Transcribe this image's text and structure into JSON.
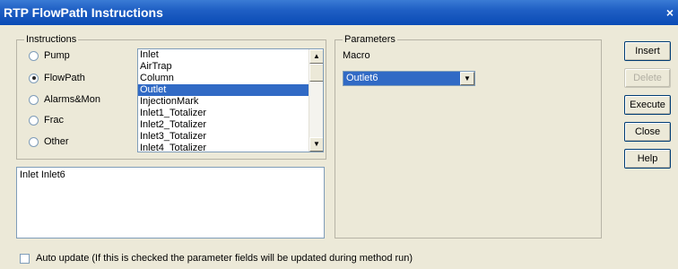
{
  "window": {
    "title": "RTP FlowPath Instructions",
    "close_glyph": "×"
  },
  "instructions": {
    "legend": "Instructions",
    "radios": [
      {
        "label": "Pump",
        "checked": false
      },
      {
        "label": "FlowPath",
        "checked": true
      },
      {
        "label": "Alarms&Mon",
        "checked": false
      },
      {
        "label": "Frac",
        "checked": false
      },
      {
        "label": "Other",
        "checked": false
      }
    ],
    "list_items": [
      "Inlet",
      "AirTrap",
      "Column",
      "Outlet",
      "InjectionMark",
      "Inlet1_Totalizer",
      "Inlet2_Totalizer",
      "Inlet3_Totalizer",
      "Inlet4_Totalizer"
    ],
    "selected_item": "Outlet"
  },
  "instruction_text": "Inlet Inlet6",
  "parameters": {
    "legend": "Parameters",
    "macro_label": "Macro",
    "macro_value": "Outlet6"
  },
  "buttons": {
    "insert": "Insert",
    "delete": "Delete",
    "execute": "Execute",
    "close": "Close",
    "help": "Help"
  },
  "auto_update": {
    "checked": false,
    "label": "Auto update (If this is checked the parameter fields will be updated during method run)"
  },
  "colors": {
    "title_bar": "#0a4bb5",
    "selection": "#316ac5",
    "face": "#ece9d8"
  }
}
